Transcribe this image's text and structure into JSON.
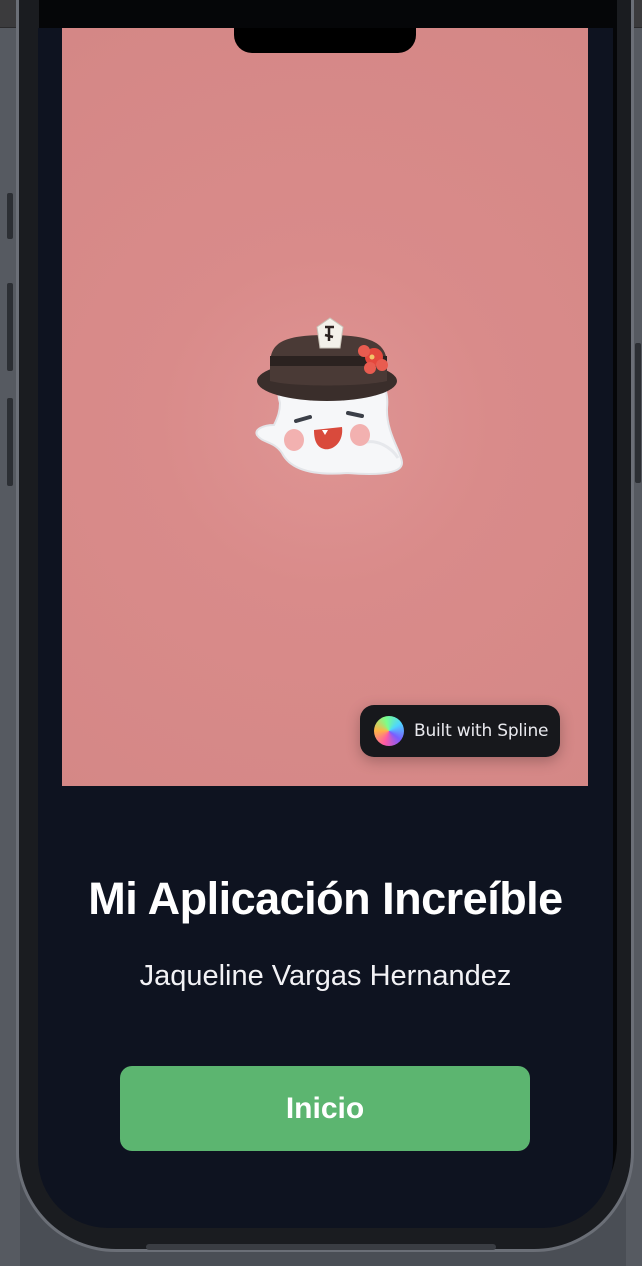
{
  "app": {
    "title": "Mi Aplicación Increíble",
    "subtitle": "Jaqueline Vargas Hernandez",
    "start_button_label": "Inicio"
  },
  "spline": {
    "badge_label": "Built with Spline",
    "badge_icon": "spline-logo-icon",
    "scene_character": "ghost-with-hat-icon",
    "background_color": "#d98b8a"
  },
  "colors": {
    "screen_background": "#0e1320",
    "button": "#5cb570",
    "text": "#ffffff"
  }
}
